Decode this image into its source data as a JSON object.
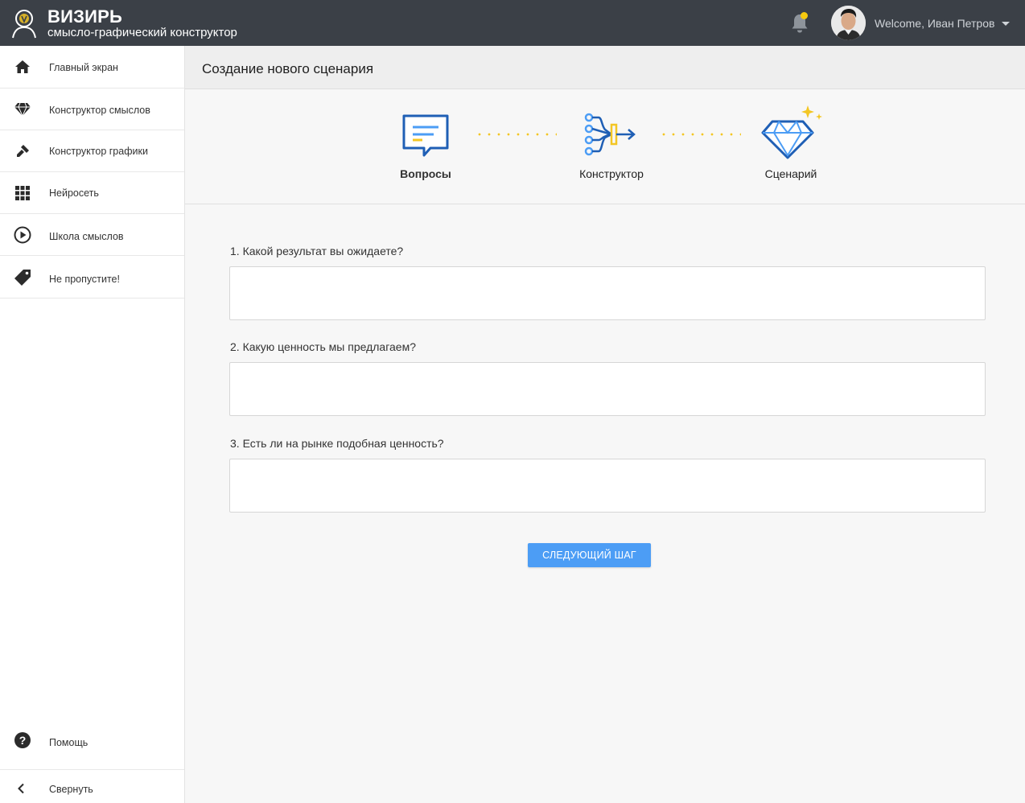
{
  "header": {
    "brand_name": "ВИЗИРЬ",
    "brand_subtitle": "смысло-графический конструктор",
    "welcome_text": "Welcome, Иван Петров",
    "icons": [
      "logo-icon",
      "bell-icon",
      "user-avatar",
      "chevron-down-icon"
    ]
  },
  "sidebar": {
    "items": [
      {
        "label": "Главный экран",
        "icon": "home-icon"
      },
      {
        "label": "Конструктор смыслов",
        "icon": "diamond-icon"
      },
      {
        "label": "Конструктор графики",
        "icon": "brush-icon"
      },
      {
        "label": "Нейросеть",
        "icon": "grid-icon"
      },
      {
        "label": "Школа смыслов",
        "icon": "play-circle-icon"
      },
      {
        "label": "Не пропустите!",
        "icon": "tag-icon"
      }
    ],
    "help_label": "Помощь",
    "collapse_label": "Свернуть"
  },
  "page": {
    "title": "Создание нового сценария"
  },
  "steps": [
    {
      "label": "Вопросы",
      "icon": "chat-bubble-icon",
      "active": true
    },
    {
      "label": "Конструктор",
      "icon": "constructor-icon",
      "active": false
    },
    {
      "label": "Сценарий",
      "icon": "diamond-sparkle-icon",
      "active": false
    }
  ],
  "questions": [
    {
      "label": "1. Какой результат вы ожидаете?",
      "value": ""
    },
    {
      "label": "2. Какую ценность мы предлагаем?",
      "value": ""
    },
    {
      "label": "3. Есть ли на рынке подобная ценность?",
      "value": ""
    }
  ],
  "next_button_label": "Следующий шаг",
  "colors": {
    "header_bg": "#3b4047",
    "accent_blue": "#4c9df5",
    "icon_blue": "#1f5fb5",
    "accent_yellow": "#f3c623"
  }
}
